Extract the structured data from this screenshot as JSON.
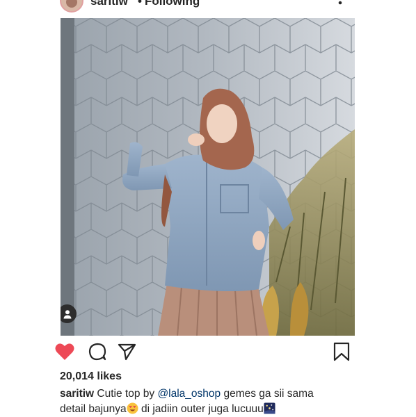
{
  "header": {
    "username": "saritiw",
    "separator": "•",
    "follow_status": "Following"
  },
  "post": {
    "likes": "20,014 likes",
    "caption": {
      "username": "saritiw",
      "text_before_mention": " Cutie top by ",
      "mention": "@lala_oshop",
      "text_after_mention": " gemes ga sii sama",
      "line2_start": "detail bajunya",
      "line2_middle": " di jadiin outer juga lucuuu",
      "emoji_1": "smiling-face-with-heart-eyes",
      "emoji_2": "night-sky-stars"
    }
  },
  "icons": {
    "like": "heart-icon",
    "comment": "comment-icon",
    "share": "paper-plane-icon",
    "save": "bookmark-icon",
    "tag": "user-tag-icon",
    "more": "more-vertical-icon"
  },
  "colors": {
    "liked": "#ed4956",
    "text": "#262626",
    "mention": "#003569"
  }
}
